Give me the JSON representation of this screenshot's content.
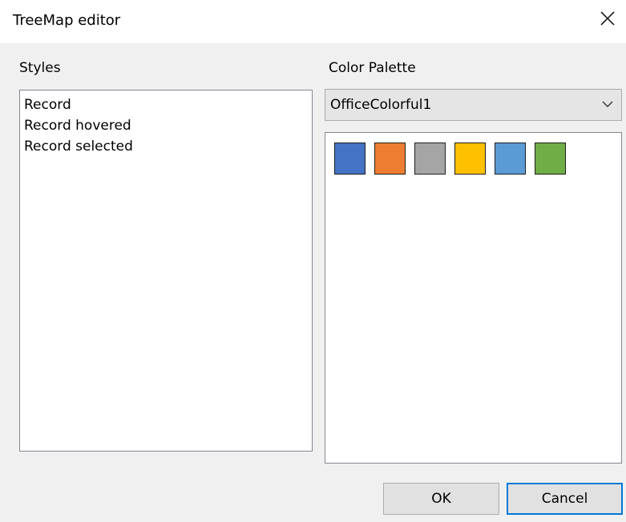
{
  "window": {
    "title": "TreeMap editor",
    "close_icon": "close-icon"
  },
  "styles": {
    "label": "Styles",
    "items": [
      "Record",
      "Record hovered",
      "Record selected"
    ]
  },
  "palette": {
    "label": "Color Palette",
    "selected": "OfficeColorful1",
    "chevron_icon": "chevron-down-icon",
    "swatches": [
      "#4472c4",
      "#ed7d31",
      "#a5a5a5",
      "#ffc000",
      "#5b9bd5",
      "#70ad47"
    ]
  },
  "buttons": {
    "ok": "OK",
    "cancel": "Cancel"
  }
}
